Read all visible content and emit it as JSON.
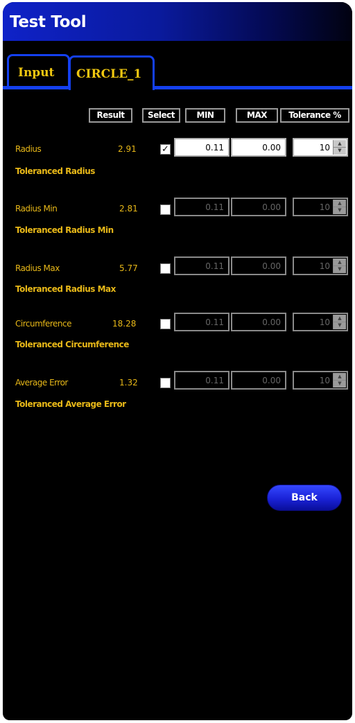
{
  "window": {
    "title": "Test Tool"
  },
  "tabs": [
    {
      "label": "Input"
    },
    {
      "label": "CIRCLE_1"
    }
  ],
  "headers": {
    "result": "Result",
    "select": "Select",
    "min": "MIN",
    "max": "MAX",
    "tolerance": "Tolerance %"
  },
  "rows": [
    {
      "label": "Radius",
      "result": "2.91",
      "selected": true,
      "min": "0.11",
      "max": "0.00",
      "tolerance": "10",
      "sub_label": "Toleranced Radius"
    },
    {
      "label": "Radius Min",
      "result": "2.81",
      "selected": false,
      "min": "0.11",
      "max": "0.00",
      "tolerance": "10",
      "sub_label": "Toleranced Radius Min"
    },
    {
      "label": "Radius Max",
      "result": "5.77",
      "selected": false,
      "min": "0.11",
      "max": "0.00",
      "tolerance": "10",
      "sub_label": "Toleranced Radius Max"
    },
    {
      "label": "Circumference",
      "result": "18.28",
      "selected": false,
      "min": "0.11",
      "max": "0.00",
      "tolerance": "10",
      "sub_label": "Toleranced Circumference"
    },
    {
      "label": "Average Error",
      "result": "1.32",
      "selected": false,
      "min": "0.11",
      "max": "0.00",
      "tolerance": "10",
      "sub_label": "Toleranced Average Error"
    }
  ],
  "checkmark_glyph": "✓",
  "back_label": "Back",
  "colors": {
    "title_bar": "#0f22c8",
    "tab_border": "#1440f0",
    "label_text": "#e8b818",
    "back_button": "#1a22d6",
    "background": "#000000"
  }
}
